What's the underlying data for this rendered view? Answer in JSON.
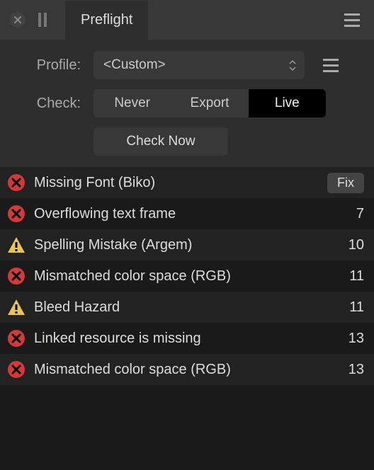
{
  "titlebar": {
    "tab_label": "Preflight"
  },
  "controls": {
    "profile_label": "Profile:",
    "profile_value": "<Custom>",
    "check_label": "Check:",
    "seg_never": "Never",
    "seg_export": "Export",
    "seg_live": "Live",
    "check_now": "Check Now"
  },
  "fix_label": "Fix",
  "issues": [
    {
      "type": "error",
      "label": "Missing Font (Biko)",
      "count": null,
      "fix": true
    },
    {
      "type": "error",
      "label": "Overflowing text frame",
      "count": "7",
      "fix": false
    },
    {
      "type": "warning",
      "label": "Spelling Mistake (Argem)",
      "count": "10",
      "fix": false
    },
    {
      "type": "error",
      "label": "Mismatched color space (RGB)",
      "count": "11",
      "fix": false
    },
    {
      "type": "warning",
      "label": "Bleed Hazard",
      "count": "11",
      "fix": false
    },
    {
      "type": "error",
      "label": "Linked resource is missing",
      "count": "13",
      "fix": false
    },
    {
      "type": "error",
      "label": "Mismatched color space (RGB)",
      "count": "13",
      "fix": false
    }
  ]
}
